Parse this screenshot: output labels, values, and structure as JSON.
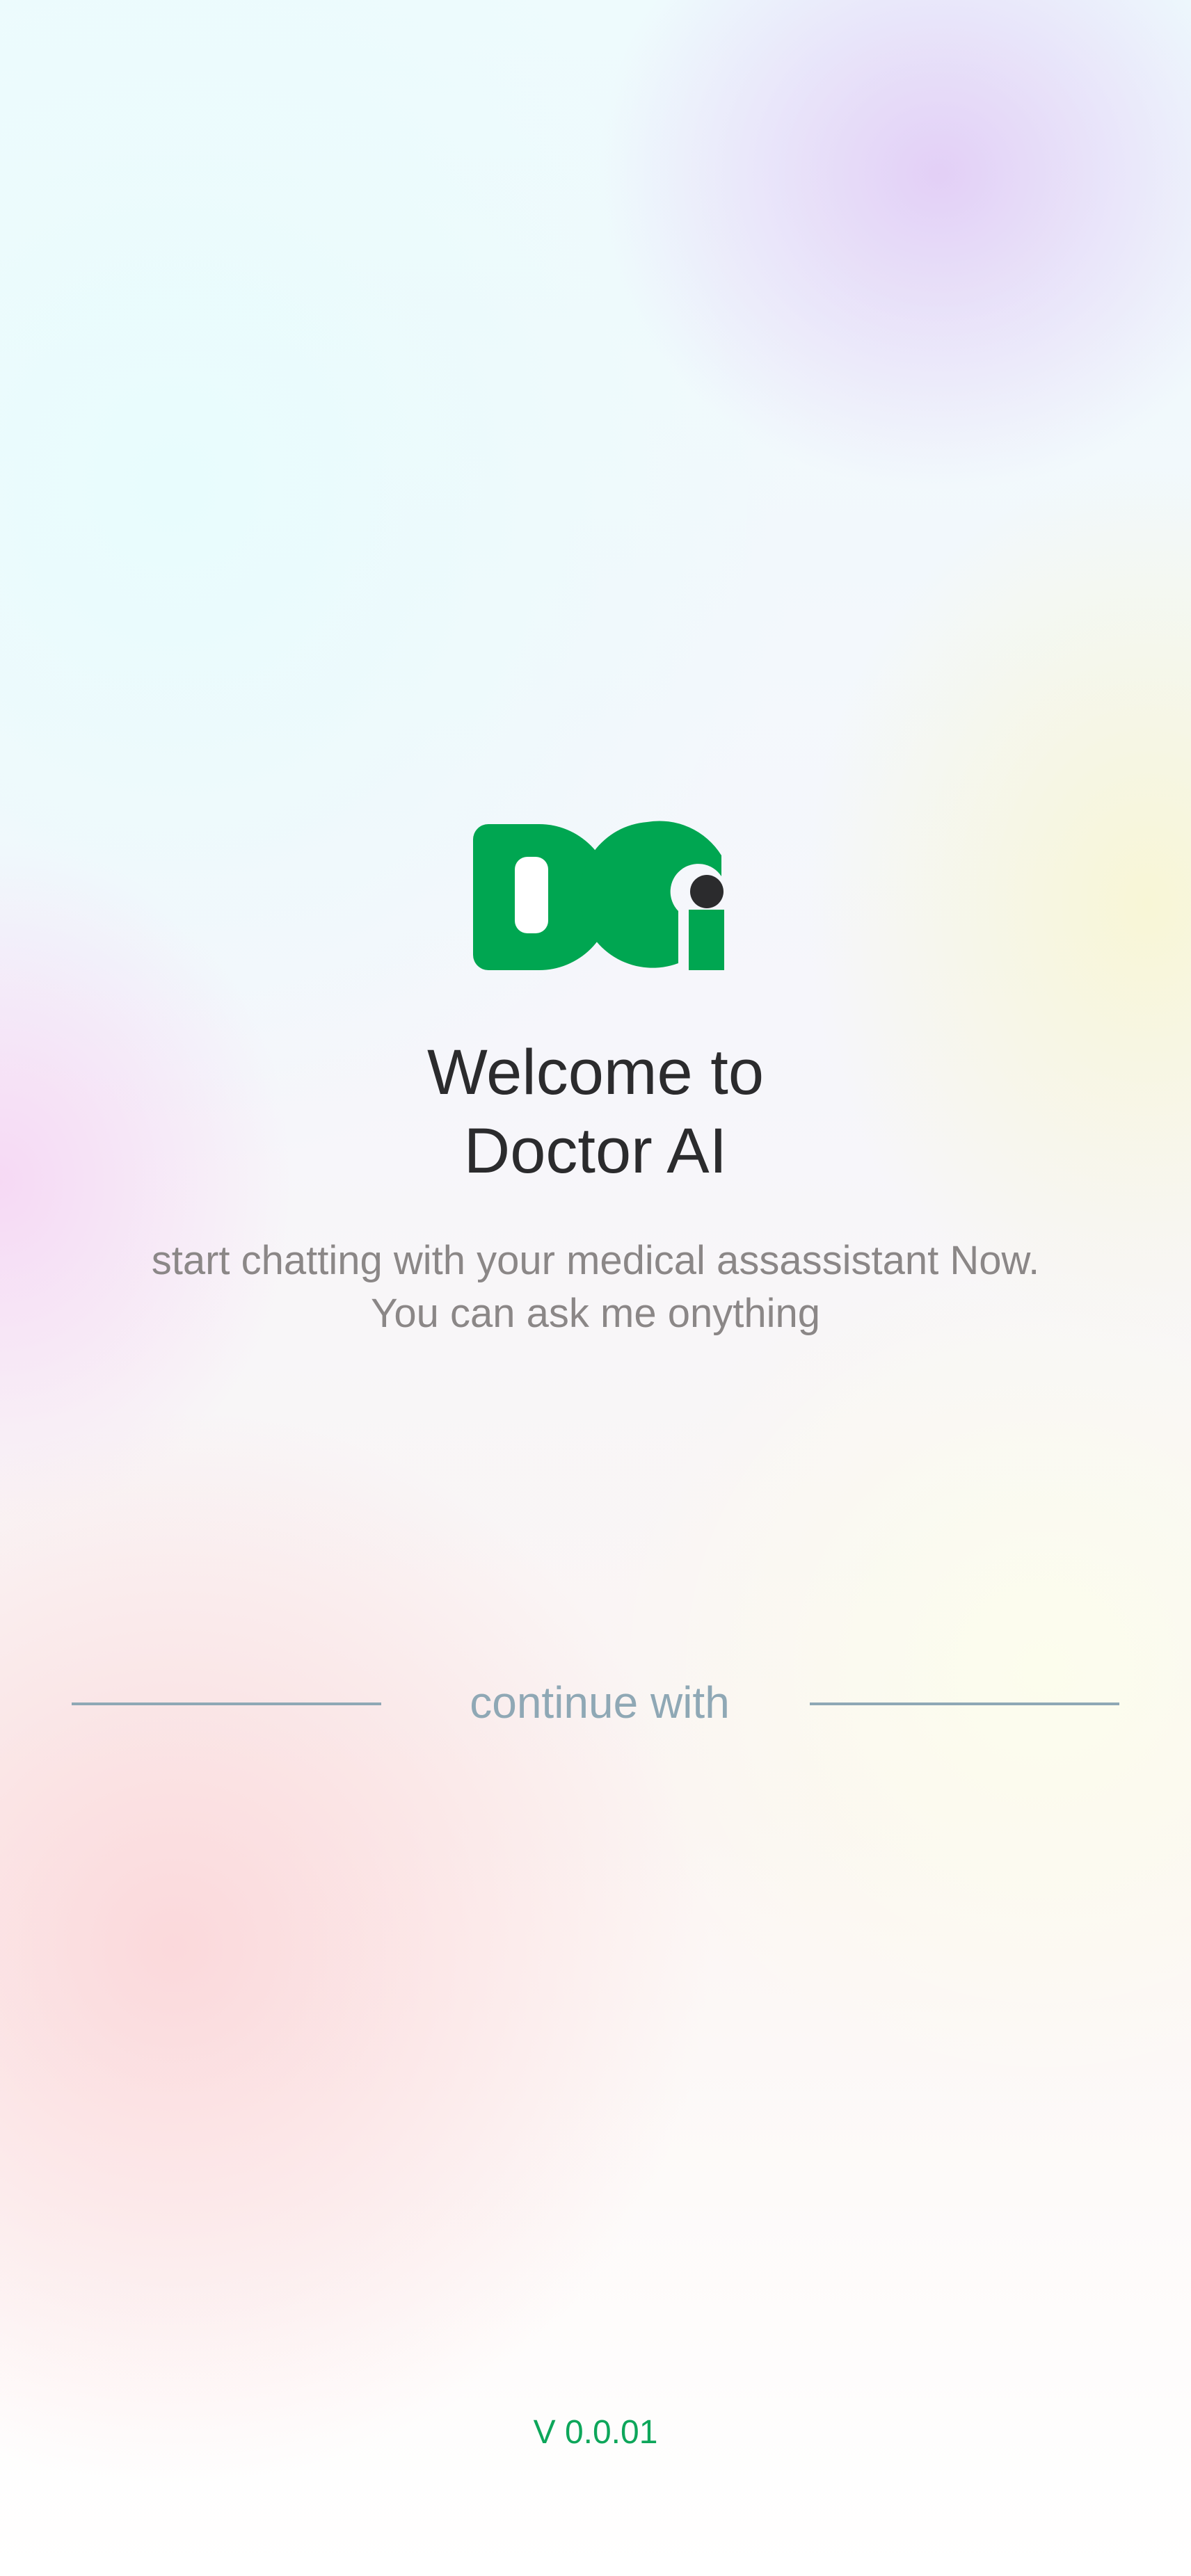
{
  "app": {
    "logo_name": "DCi logo",
    "brand_color": "#00A651",
    "dot_color": "#2B2B2D"
  },
  "welcome": {
    "title_line1": "Welcome to",
    "title_line2": "Doctor AI",
    "subtitle_line1": "start chatting with your medical assassistant  Now.",
    "subtitle_line2": "You can ask me onything"
  },
  "auth": {
    "continue_label": "continue with"
  },
  "footer": {
    "version": "V 0.0.01"
  }
}
